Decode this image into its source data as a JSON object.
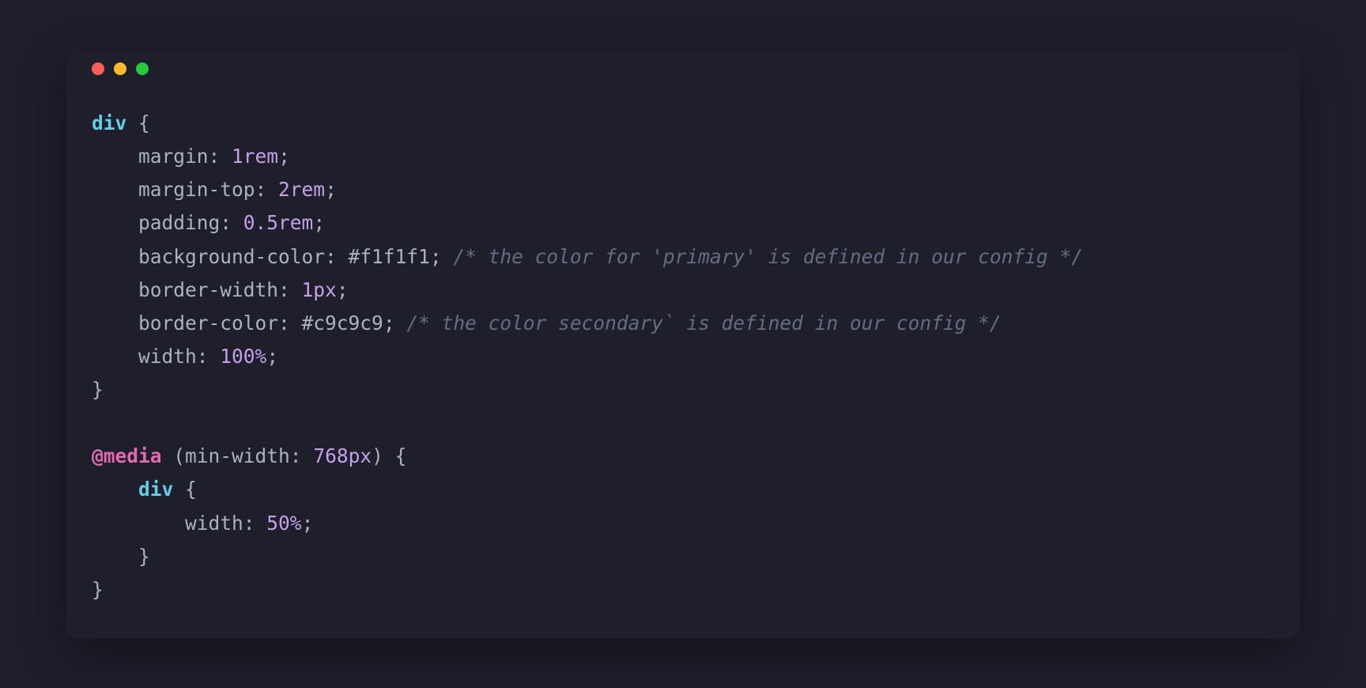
{
  "colors": {
    "bg": "#1e1f2b",
    "dot_red": "#ff5f56",
    "dot_yellow": "#ffbd2e",
    "dot_green": "#27c93f",
    "text": "#abb2bf",
    "selector": "#61cee9",
    "keyword": "#e06ab4",
    "number": "#c4a0e8",
    "comment": "#636d83"
  },
  "code": {
    "sel_div": "div",
    "brace_open": " {",
    "brace_close": "}",
    "indent1": "    ",
    "indent2": "        ",
    "p_margin": "margin",
    "v_margin": "1rem",
    "p_margin_top": "margin-top",
    "v_margin_top": "2rem",
    "p_padding": "padding",
    "v_padding": "0.5rem",
    "p_bgcol": "background-color",
    "v_bgcol": "#f1f1f1",
    "c_bgcol": "/* the color for 'primary' is defined in our config */",
    "p_bw": "border-width",
    "v_bw": "1px",
    "p_bc": "border-color",
    "v_bc": "#c9c9c9",
    "c_bc": "/* the color secondary` is defined in our config */",
    "p_width": "width",
    "v_width": "100%",
    "kw_media": "@media",
    "media_cond_open": " (",
    "media_prop": "min-width",
    "media_val": "768px",
    "media_cond_close": ") {",
    "v_width2": "50%",
    "colon": ": ",
    "semi": ";"
  }
}
